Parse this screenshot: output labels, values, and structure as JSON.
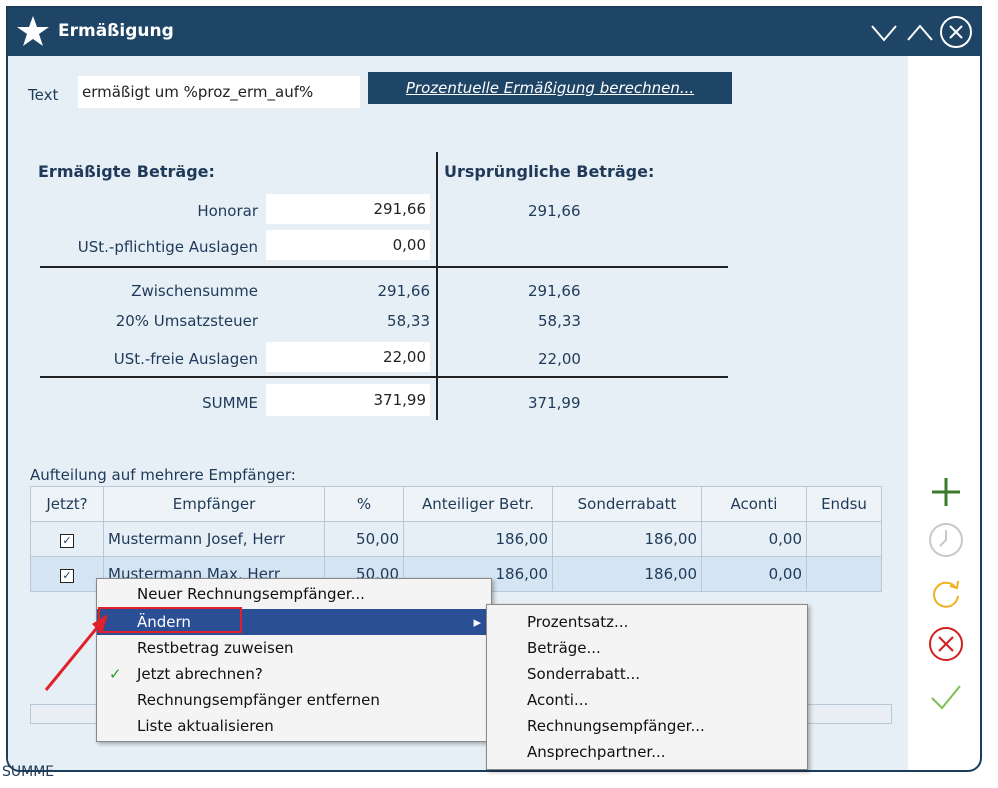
{
  "window": {
    "title": "Ermäßigung"
  },
  "form": {
    "text_label": "Text",
    "text_value": "ermäßigt um %proz_erm_auf%",
    "calc_button": "Prozentuelle Ermäßigung berechnen..."
  },
  "sums": {
    "left_header": "Ermäßigte Beträge:",
    "right_header": "Ursprüngliche Beträge:",
    "rows": [
      {
        "label": "Honorar",
        "value": "291,66",
        "orig": "291,66"
      },
      {
        "label": "USt.-pflichtige Auslagen",
        "value": "0,00",
        "orig": ""
      },
      {
        "label": "Zwischensumme",
        "value": "291,66",
        "orig": "291,66"
      },
      {
        "label": "20% Umsatzsteuer",
        "value": "58,33",
        "orig": "58,33"
      },
      {
        "label": "USt.-freie Auslagen",
        "value": "22,00",
        "orig": "22,00"
      },
      {
        "label": "SUMME",
        "value": "371,99",
        "orig": "371,99"
      }
    ]
  },
  "split": {
    "label": "Aufteilung auf mehrere Empfänger:",
    "columns": [
      "Jetzt?",
      "Empfänger",
      "%",
      "Anteiliger Betr.",
      "Sonderrabatt",
      "Aconti",
      "Endsu"
    ],
    "rows": [
      {
        "checked": "✓",
        "name": "Mustermann Josef, Herr",
        "pct": "50,00",
        "share": "186,00",
        "rabatt": "186,00",
        "aconti": "0,00",
        "end": ""
      },
      {
        "checked": "✓",
        "name": "Mustermann Max, Herr",
        "pct": "50,00",
        "share": "186,00",
        "rabatt": "186,00",
        "aconti": "0,00",
        "end": ""
      }
    ]
  },
  "bottom": {
    "text": "SUMME"
  },
  "context_menu": {
    "items": [
      "Neuer Rechnungsempfänger...",
      "Ändern",
      "Restbetrag zuweisen",
      "Jetzt abrechnen?",
      "Rechnungsempfänger entfernen",
      "Liste aktualisieren"
    ],
    "checkmark": "✓",
    "submenu_arrow": "▸"
  },
  "submenu": {
    "items": [
      "Prozentsatz...",
      "Beträge...",
      "Sonderrabatt...",
      "Aconti...",
      "Rechnungsempfänger...",
      "Ansprechpartner..."
    ]
  },
  "sidebar": {
    "icons": [
      "plus-icon",
      "clock-icon",
      "refresh-icon",
      "cancel-icon",
      "confirm-icon"
    ]
  },
  "colors": {
    "titlebar": "#1e4466",
    "accent": "#2b4f95",
    "highlight_box": "#e0202a",
    "plus": "#3a7a2a",
    "refresh": "#f0b020",
    "cancel": "#d02020",
    "confirm": "#7cc050"
  }
}
